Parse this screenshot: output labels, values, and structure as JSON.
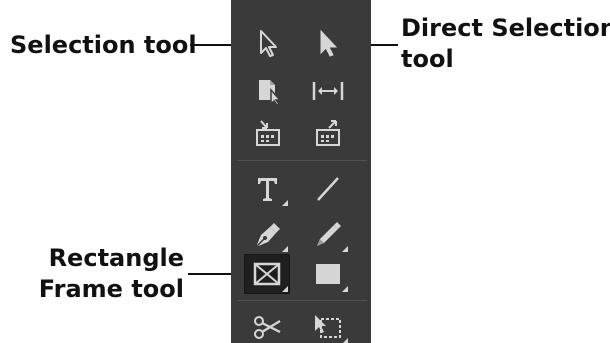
{
  "callouts": {
    "selection_tool": "Selection tool",
    "direct_selection_line1": "Direct Selection",
    "direct_selection_line2": "tool",
    "rectangle_frame_line1": "Rectangle",
    "rectangle_frame_line2": "Frame tool"
  },
  "colors": {
    "panel": "#3a3a3a",
    "icon": "#d6d6d6",
    "selected_tool_bg": "#1f1f1f",
    "label_text": "#111111"
  },
  "tools": {
    "row1": [
      "selection-tool",
      "direct-selection-tool"
    ],
    "row2": [
      "page-tool",
      "gap-tool"
    ],
    "row3": [
      "content-collector-tool",
      "content-placer-tool"
    ],
    "row4": [
      "type-tool",
      "line-tool"
    ],
    "row5": [
      "pen-tool",
      "pencil-tool"
    ],
    "row6": [
      "rectangle-frame-tool",
      "rectangle-tool"
    ],
    "row7": [
      "scissors-tool",
      "free-transform-tool"
    ],
    "selected": "rectangle-frame-tool"
  }
}
